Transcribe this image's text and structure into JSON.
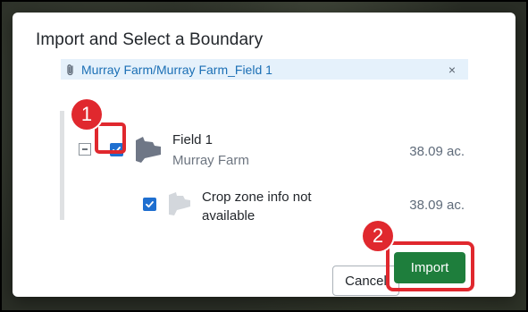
{
  "dialog": {
    "title": "Import and Select a Boundary",
    "file_chip": {
      "path": "Murray Farm/Murray Farm_Field 1",
      "close_glyph": "×"
    },
    "tree": {
      "field": {
        "name": "Field 1",
        "farm": "Murray Farm",
        "area": "38.09 ac.",
        "checked": true,
        "expanded": true
      },
      "crop_zone": {
        "name": "Crop zone info not available",
        "area": "38.09 ac.",
        "checked": true
      }
    },
    "buttons": {
      "cancel": "Cancel",
      "import": "Import"
    }
  },
  "annotations": {
    "step1": "1",
    "step2": "2"
  },
  "colors": {
    "accent": "#1f6fd0",
    "import_button": "#1e7e3c",
    "highlight": "#e0282e",
    "chip_bg": "#e5f1fb",
    "link": "#1b6fb5"
  },
  "icons": [
    "paperclip-icon",
    "close-icon",
    "collapse-icon",
    "checkbox-checked-icon",
    "field-shape-icon",
    "crop-zone-shape-icon"
  ]
}
